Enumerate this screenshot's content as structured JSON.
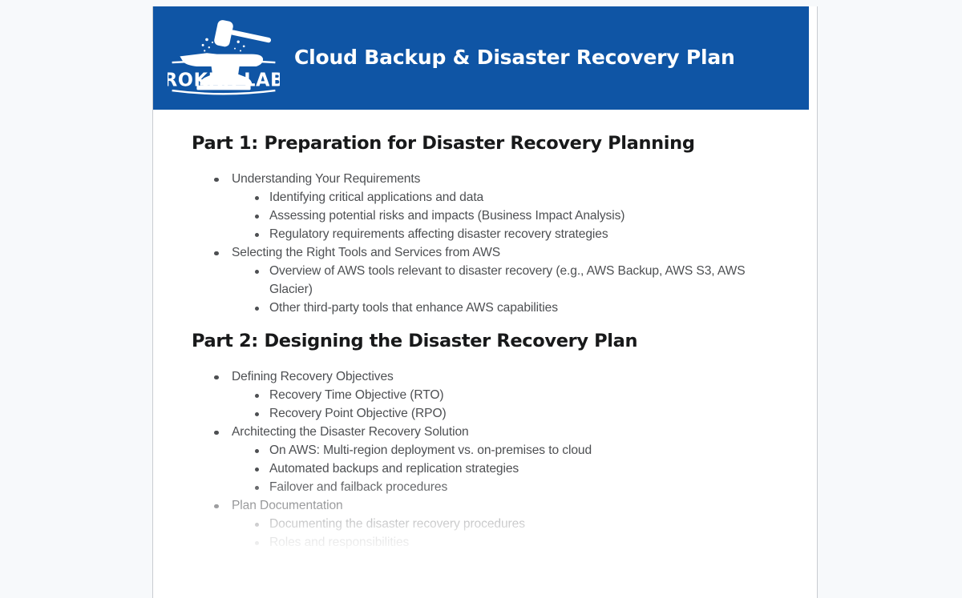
{
  "theme": {
    "header_blue": "#0f55a5",
    "page_background": "#ffffff",
    "canvas_background": "#f7f9fb",
    "heading_color": "#18191a",
    "body_text_color": "#4d4f52"
  },
  "header": {
    "title": "Cloud Backup & Disaster Recovery Plan",
    "logo": {
      "name": "brokkr-labs-logo",
      "wordmark": "BROKKR LABS",
      "icon": "anvil-and-hammer-icon"
    }
  },
  "document": {
    "sections": [
      {
        "heading": "Part 1: Preparation for Disaster Recovery Planning",
        "items": [
          {
            "text": "Understanding Your Requirements",
            "children": [
              "Identifying critical applications and data",
              "Assessing potential risks and impacts (Business Impact Analysis)",
              "Regulatory requirements affecting disaster recovery strategies"
            ]
          },
          {
            "text": "Selecting the Right Tools and Services from AWS",
            "children": [
              "Overview of AWS tools relevant to disaster recovery (e.g., AWS Backup, AWS S3, AWS Glacier)",
              "Other third-party tools that enhance AWS capabilities"
            ]
          }
        ]
      },
      {
        "heading": "Part 2: Designing the Disaster Recovery Plan",
        "items": [
          {
            "text": "Defining Recovery Objectives",
            "children": [
              "Recovery Time Objective (RTO)",
              "Recovery Point Objective (RPO)"
            ]
          },
          {
            "text": "Architecting the Disaster Recovery Solution",
            "children": [
              "On AWS: Multi-region deployment vs. on-premises to cloud",
              "Automated backups and replication strategies",
              "Failover and failback procedures"
            ]
          },
          {
            "text": "Plan Documentation",
            "children": [
              "Documenting the disaster recovery procedures",
              "Roles and responsibilities"
            ]
          }
        ]
      }
    ]
  }
}
